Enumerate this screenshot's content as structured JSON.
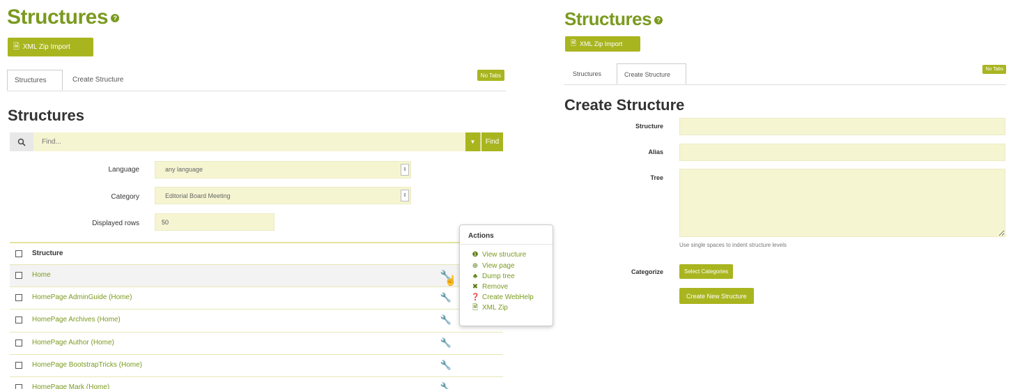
{
  "left": {
    "page_title": "Structures",
    "help_icon": "question-circle-icon",
    "import_button": "XML Zip Import",
    "tabs": [
      "Structures",
      "Create Structure"
    ],
    "no_tabs_button": "No Tabs",
    "section_title": "Structures",
    "search": {
      "placeholder": "Find...",
      "find_button": "Find"
    },
    "filters": {
      "language_label": "Language",
      "language_value": "any language",
      "category_label": "Category",
      "category_value": "Editorial Board Meeting",
      "rows_label": "Displayed rows",
      "rows_value": "50"
    },
    "table": {
      "header": "Structure",
      "rows": [
        "Home",
        "HomePage AdminGuide (Home)",
        "HomePage Archives (Home)",
        "HomePage Author (Home)",
        "HomePage BootstrapTricks (Home)",
        "HomePage Mark (Home)"
      ]
    },
    "actions_popover": {
      "title": "Actions",
      "items": [
        {
          "label": "View structure",
          "icon": "info-circle-icon"
        },
        {
          "label": "View page",
          "icon": "search-plus-icon"
        },
        {
          "label": "Dump tree",
          "icon": "sitemap-icon"
        },
        {
          "label": "Remove",
          "icon": "times-icon"
        },
        {
          "label": "Create WebHelp",
          "icon": "question-circle-icon"
        },
        {
          "label": "XML Zip",
          "icon": "file-icon"
        }
      ]
    }
  },
  "right": {
    "page_title": "Structures",
    "import_button": "XML Zip Import",
    "tabs": [
      "Structures",
      "Create Structure"
    ],
    "no_tabs_button": "No Tabs",
    "section_title": "Create Structure",
    "form": {
      "structure_label": "Structure",
      "alias_label": "Alias",
      "tree_label": "Tree",
      "tree_help": "Use single spaces to indent structure levels",
      "categorize_label": "Categorize",
      "select_categories_button": "Select Categories",
      "create_button": "Create New Structure"
    }
  },
  "colors": {
    "accent": "#a9b51f",
    "title": "#7a9a1f",
    "field_bg": "#f5f5d2"
  }
}
